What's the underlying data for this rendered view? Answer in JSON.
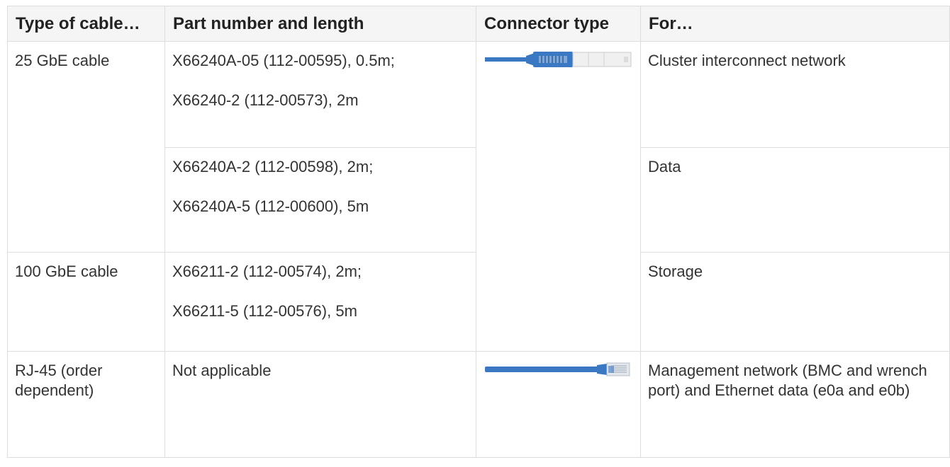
{
  "table": {
    "headers": [
      "Type of cable…",
      "Part number and length",
      "Connector type",
      "For…"
    ],
    "rows": [
      {
        "type": "25 GbE cable",
        "parts": [
          "X66240A-05 (112-00595), 0.5m;",
          "X66240-2 (112-00573), 2m"
        ],
        "connector_icon": "sfp28-cable-connector-icon",
        "for": "Cluster interconnect network"
      },
      {
        "type": "",
        "parts": [
          "X66240A-2 (112-00598), 2m;",
          "X66240A-5 (112-00600), 5m"
        ],
        "connector_icon": "",
        "for": "Data"
      },
      {
        "type": "100 GbE cable",
        "parts": [
          "X66211-2 (112-00574), 2m;",
          "X66211-5 (112-00576), 5m"
        ],
        "connector_icon": "",
        "for": "Storage"
      },
      {
        "type": "RJ-45 (order dependent)",
        "parts": [
          "Not applicable"
        ],
        "connector_icon": "rj45-cable-connector-icon",
        "for": "Management network (BMC and wrench port) and Ethernet data (e0a and e0b)"
      }
    ]
  },
  "colors": {
    "header_bg": "#f5f5f5",
    "border": "#dddddd",
    "cable_blue": "#3a78c3"
  }
}
